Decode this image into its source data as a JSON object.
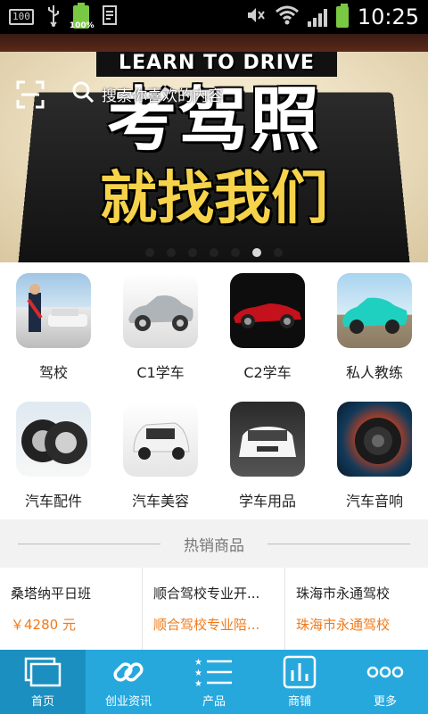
{
  "status_bar": {
    "left_box": "100",
    "battery_percent": "100%",
    "time": "10:25"
  },
  "banner": {
    "headline_en": "LEARN TO DRIVE",
    "headline_line1": "考驾照",
    "headline_line2": "就找我们",
    "slide_count": 7,
    "active_slide": 6
  },
  "search": {
    "placeholder": "搜索你喜欢的内容"
  },
  "categories": [
    {
      "label": "驾校",
      "icon": "driving-school-photo"
    },
    {
      "label": "C1学车",
      "icon": "silver-car-photo"
    },
    {
      "label": "C2学车",
      "icon": "red-convertible-photo"
    },
    {
      "label": "私人教练",
      "icon": "teal-car-photo"
    },
    {
      "label": "汽车配件",
      "icon": "tires-photo"
    },
    {
      "label": "汽车美容",
      "icon": "white-car-photo"
    },
    {
      "label": "学车用品",
      "icon": "car-front-photo"
    },
    {
      "label": "汽车音响",
      "icon": "speaker-photo"
    }
  ],
  "hot": {
    "title": "热销商品",
    "products": [
      {
        "name": "桑塔纳平日班",
        "price": "￥4280 元"
      },
      {
        "name": "顺合驾校专业开...",
        "price": "顺合驾校专业陪..."
      },
      {
        "name": "珠海市永通驾校",
        "price": "珠海市永通驾校"
      }
    ]
  },
  "nav": {
    "active": "home",
    "items": [
      {
        "key": "home",
        "label": "首页",
        "icon": "home-windows-icon"
      },
      {
        "key": "news",
        "label": "创业资讯",
        "icon": "link-chain-icon"
      },
      {
        "key": "products",
        "label": "产品",
        "icon": "list-stars-icon"
      },
      {
        "key": "shops",
        "label": "商铺",
        "icon": "bar-chart-icon"
      },
      {
        "key": "more",
        "label": "更多",
        "icon": "more-dots-icon"
      }
    ]
  },
  "colors": {
    "nav_bg": "#27a8dd",
    "nav_active": "#1b8fc0",
    "price": "#f07a1a"
  }
}
